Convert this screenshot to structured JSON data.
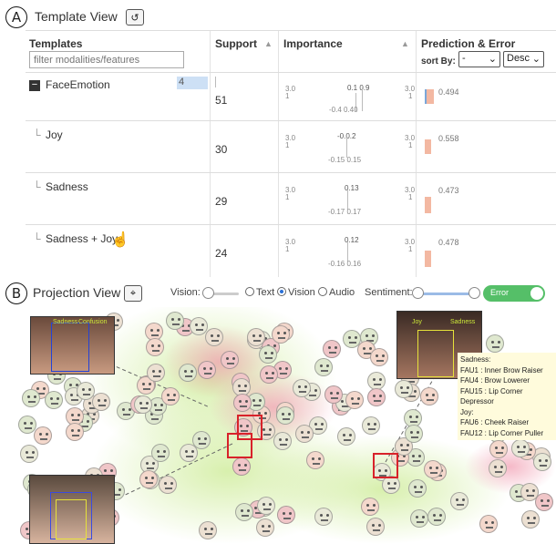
{
  "template_view": {
    "letter": "A",
    "title": "Template View",
    "headers": {
      "templates": "Templates",
      "support": "Support",
      "importance": "Importance",
      "prediction": "Prediction & Error"
    },
    "filter_placeholder": "filter modalities/features",
    "sort_by_label": "sort By:",
    "sort_field_value": "-",
    "sort_order_value": "Desc",
    "rows": [
      {
        "name": "FaceEmotion",
        "count": "4",
        "support": "51",
        "tick_left": "3.0",
        "tick_left2": "1",
        "tick_right": "3.0",
        "tick_right2": "1",
        "imp_top": "0.1  0.9",
        "imp_bottom": "-0.4    0.40",
        "pred": "0.494",
        "pred_fraction": 0.494
      },
      {
        "name": "Joy",
        "support": "30",
        "tick_left": "3.0",
        "tick_left2": "1",
        "tick_right": "3.0",
        "tick_right2": "1",
        "imp_top": "-0.0.2",
        "imp_bottom": "-0.15  0.15",
        "pred": "0.558",
        "pred_fraction": 0.558
      },
      {
        "name": "Sadness",
        "support": "29",
        "tick_left": "3.0",
        "tick_left2": "1",
        "tick_right": "3.0",
        "tick_right2": "1",
        "imp_top": "0.13",
        "imp_bottom": "-0.17  0.17",
        "pred": "0.473",
        "pred_fraction": 0.473
      },
      {
        "name": "Sadness + Joy",
        "support": "24",
        "tick_left": "3.0",
        "tick_left2": "1",
        "tick_right": "3.0",
        "tick_right2": "1",
        "imp_top": "0.12",
        "imp_bottom": "-0.16  0.16",
        "pred": "0.478",
        "pred_fraction": 0.478
      }
    ],
    "row_prefix": "└",
    "collapse_symbol": "−"
  },
  "projection_view": {
    "letter": "B",
    "title": "Projection View",
    "vision_label": "Vision:",
    "vision_level": 0.1,
    "radio_options": [
      "Text",
      "Vision",
      "Audio"
    ],
    "radio_selected": "Vision",
    "sentiment_label": "Sentiment:",
    "toggle_label": "Error",
    "thumb1_labels": [
      "Sadness",
      "Confusion"
    ],
    "thumb2_labels": [
      "Joy",
      "Sadness"
    ],
    "tooltip_lines": [
      "Sadness:",
      "FAU1 : Inner Brow Raiser",
      "FAU4 : Brow Lowerer",
      "FAU15 : Lip Corner Depressor",
      "Joy:",
      "FAU6 : Cheek Raiser",
      "FAU12 : Lip Corner Puller"
    ]
  },
  "colors": {
    "accent": "#55bf68",
    "highlight": "#d8222a",
    "error_bar": "#f3b8a2"
  },
  "icons": [
    "undo-icon",
    "lasso-select-icon",
    "cursor-hand-icon"
  ]
}
